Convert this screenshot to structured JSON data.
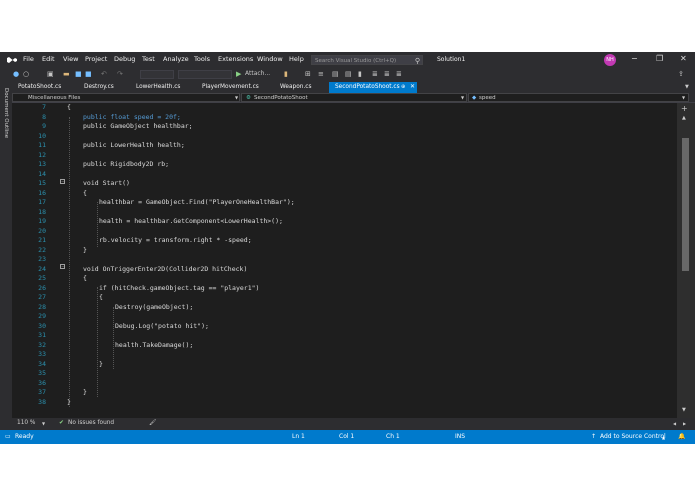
{
  "menu": {
    "items": [
      "File",
      "Edit",
      "View",
      "Project",
      "Debug",
      "Test",
      "Analyze",
      "Tools",
      "Extensions",
      "Window",
      "Help"
    ],
    "search_placeholder": "Search Visual Studio (Ctrl+Q)",
    "solution": "Solution1",
    "user_initials": "NH"
  },
  "toolbar": {
    "attach_label": "Attach..."
  },
  "side_panel": {
    "label": "Document Outline"
  },
  "tabs": [
    {
      "label": "PotatoShoot.cs",
      "active": false
    },
    {
      "label": "Destroy.cs",
      "active": false
    },
    {
      "label": "LowerHealth.cs",
      "active": false
    },
    {
      "label": "PlayerMovement.cs",
      "active": false
    },
    {
      "label": "Weapon.cs",
      "active": false
    },
    {
      "label": "SecondPotatoShoot.cs",
      "active": true
    }
  ],
  "navbar": {
    "project": "Miscellaneous Files",
    "class": "SecondPotatoShoot",
    "member": "speed"
  },
  "code_lines": [
    {
      "n": "7",
      "text": "{"
    },
    {
      "n": "8",
      "text": "public float speed = 20f;"
    },
    {
      "n": "9",
      "text": "public GameObject healthbar;"
    },
    {
      "n": "10",
      "text": ""
    },
    {
      "n": "11",
      "text": "public LowerHealth health;"
    },
    {
      "n": "12",
      "text": ""
    },
    {
      "n": "13",
      "text": "public Rigidbody2D rb;"
    },
    {
      "n": "14",
      "text": ""
    },
    {
      "n": "15",
      "text": "void Start()"
    },
    {
      "n": "16",
      "text": "{"
    },
    {
      "n": "17",
      "text": "healthbar = GameObject.Find(\"PlayerOneHealthBar\");"
    },
    {
      "n": "18",
      "text": ""
    },
    {
      "n": "19",
      "text": "health = healthbar.GetComponent<LowerHealth>();"
    },
    {
      "n": "20",
      "text": ""
    },
    {
      "n": "21",
      "text": "rb.velocity = transform.right * -speed;"
    },
    {
      "n": "22",
      "text": "}"
    },
    {
      "n": "23",
      "text": ""
    },
    {
      "n": "24",
      "text": "void OnTriggerEnter2D(Collider2D hitCheck)"
    },
    {
      "n": "25",
      "text": "{"
    },
    {
      "n": "26",
      "text": "if (hitCheck.gameObject.tag == \"player1\")"
    },
    {
      "n": "27",
      "text": "{"
    },
    {
      "n": "28",
      "text": "Destroy(gameObject);"
    },
    {
      "n": "29",
      "text": ""
    },
    {
      "n": "30",
      "text": "Debug.Log(\"potato hit\");"
    },
    {
      "n": "31",
      "text": ""
    },
    {
      "n": "32",
      "text": "health.TakeDamage();"
    },
    {
      "n": "33",
      "text": ""
    },
    {
      "n": "34",
      "text": "}"
    },
    {
      "n": "35",
      "text": ""
    },
    {
      "n": "36",
      "text": ""
    },
    {
      "n": "37",
      "text": "}"
    },
    {
      "n": "38",
      "text": "}"
    }
  ],
  "editor_footer": {
    "zoom": "110 %",
    "issues": "No issues found"
  },
  "status": {
    "state": "Ready",
    "line": "Ln 1",
    "col": "Col 1",
    "ch": "Ch 1",
    "mode": "INS",
    "source_control": "Add to Source Control"
  },
  "colors": {
    "accent": "#007acc",
    "editor_bg": "#1e1e1e",
    "chrome": "#2d2d30",
    "avatar": "#c239b3"
  }
}
